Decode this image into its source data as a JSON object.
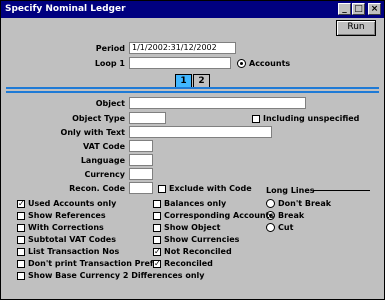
{
  "window": {
    "title": "Specify Nominal Ledger"
  },
  "toolbar": {
    "run_label": "Run"
  },
  "controls": {
    "minimize": "_",
    "maximize": "□",
    "close": "×"
  },
  "header": {
    "period_label": "Period",
    "period_value": "1/1/2002:31/12/2002",
    "loop_label": "Loop 1",
    "loop_value": "",
    "accounts_label": "Accounts"
  },
  "tabs": [
    {
      "label": "1"
    },
    {
      "label": "2"
    }
  ],
  "fields": {
    "object": "Object",
    "object_type": "Object Type",
    "including_unspecified": "Including unspecified",
    "only_with_text": "Only with Text",
    "vat_code": "VAT Code",
    "language": "Language",
    "currency": "Currency",
    "recon_code": "Recon. Code",
    "exclude_with_code": "Exclude with Code"
  },
  "long_lines": {
    "title": "Long Lines",
    "options": [
      "Don't Break",
      "Break",
      "Cut"
    ],
    "selected": "Break"
  },
  "checkboxes_left": [
    {
      "label": "Used Accounts only",
      "checked": true
    },
    {
      "label": "Show References",
      "checked": false
    },
    {
      "label": "With Corrections",
      "checked": false
    },
    {
      "label": "Subtotal VAT Codes",
      "checked": false
    },
    {
      "label": "List Transaction Nos",
      "checked": false
    },
    {
      "label": "Don't print Transaction Prefix",
      "checked": false
    },
    {
      "label": "Show Base Currency 2 Differences only",
      "checked": false
    }
  ],
  "checkboxes_right": [
    {
      "label": "Balances only",
      "checked": false
    },
    {
      "label": "Corresponding Accounts",
      "checked": false
    },
    {
      "label": "Show Object",
      "checked": false
    },
    {
      "label": "Show Currencies",
      "checked": false
    },
    {
      "label": "Not Reconciled",
      "checked": true
    },
    {
      "label": "Reconciled",
      "checked": true
    }
  ],
  "colors": {
    "titlebar": "#000080",
    "separator": "#1e7ad6",
    "tab_active": "#41b7ff"
  }
}
